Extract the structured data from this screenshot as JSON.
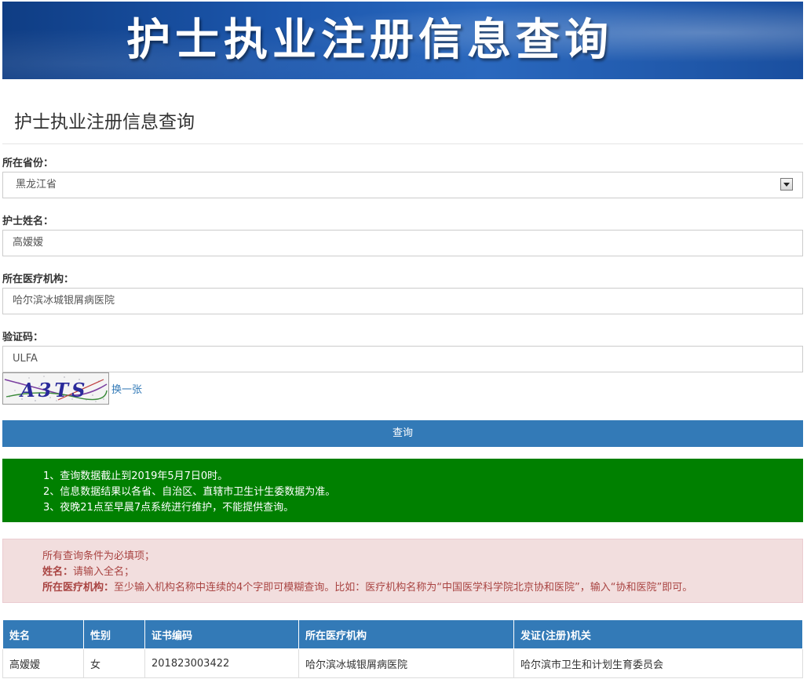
{
  "banner": {
    "title": "护士执业注册信息查询"
  },
  "page_title": "护士执业注册信息查询",
  "form": {
    "province_label": "所在省份：",
    "province_value": "黑龙江省",
    "name_label": "护士姓名：",
    "name_value": "高嫒嫒",
    "institution_label": "所在医疗机构：",
    "institution_value": "哈尔滨冰城银屑病医院",
    "captcha_label": "验证码：",
    "captcha_value": "ULFA",
    "captcha_image_text": "A3TS",
    "captcha_refresh": "换一张",
    "submit_label": "查询"
  },
  "notice_green": [
    "1、查询数据截止到2019年5月7日0时。",
    "2、信息数据结果以各省、自治区、直辖市卫生计生委数据为准。",
    "3、夜晚21点至早晨7点系统进行维护，不能提供查询。"
  ],
  "notice_red": {
    "line1": "所有查询条件为必填项；",
    "line2_key": "姓名：",
    "line2_text": "请输入全名；",
    "line3_key": "所在医疗机构：",
    "line3_text": "至少输入机构名称中连续的4个字即可模糊查询。比如：医疗机构名称为“中国医学科学院北京协和医院”，输入“协和医院”即可。"
  },
  "table": {
    "headers": [
      "姓名",
      "性别",
      "证书编码",
      "所在医疗机构",
      "发证(注册)机关"
    ],
    "rows": [
      [
        "高嫒嫒",
        "女",
        "201823003422",
        "哈尔滨冰城银屑病医院",
        "哈尔滨市卫生和计划生育委员会"
      ]
    ]
  },
  "colors": {
    "primary": "#337ab7",
    "notice_green_bg": "#008000",
    "notice_red_bg": "#f2dede",
    "notice_red_text": "#a94442"
  },
  "icons": {
    "select_arrow": "chevron-down-icon"
  }
}
